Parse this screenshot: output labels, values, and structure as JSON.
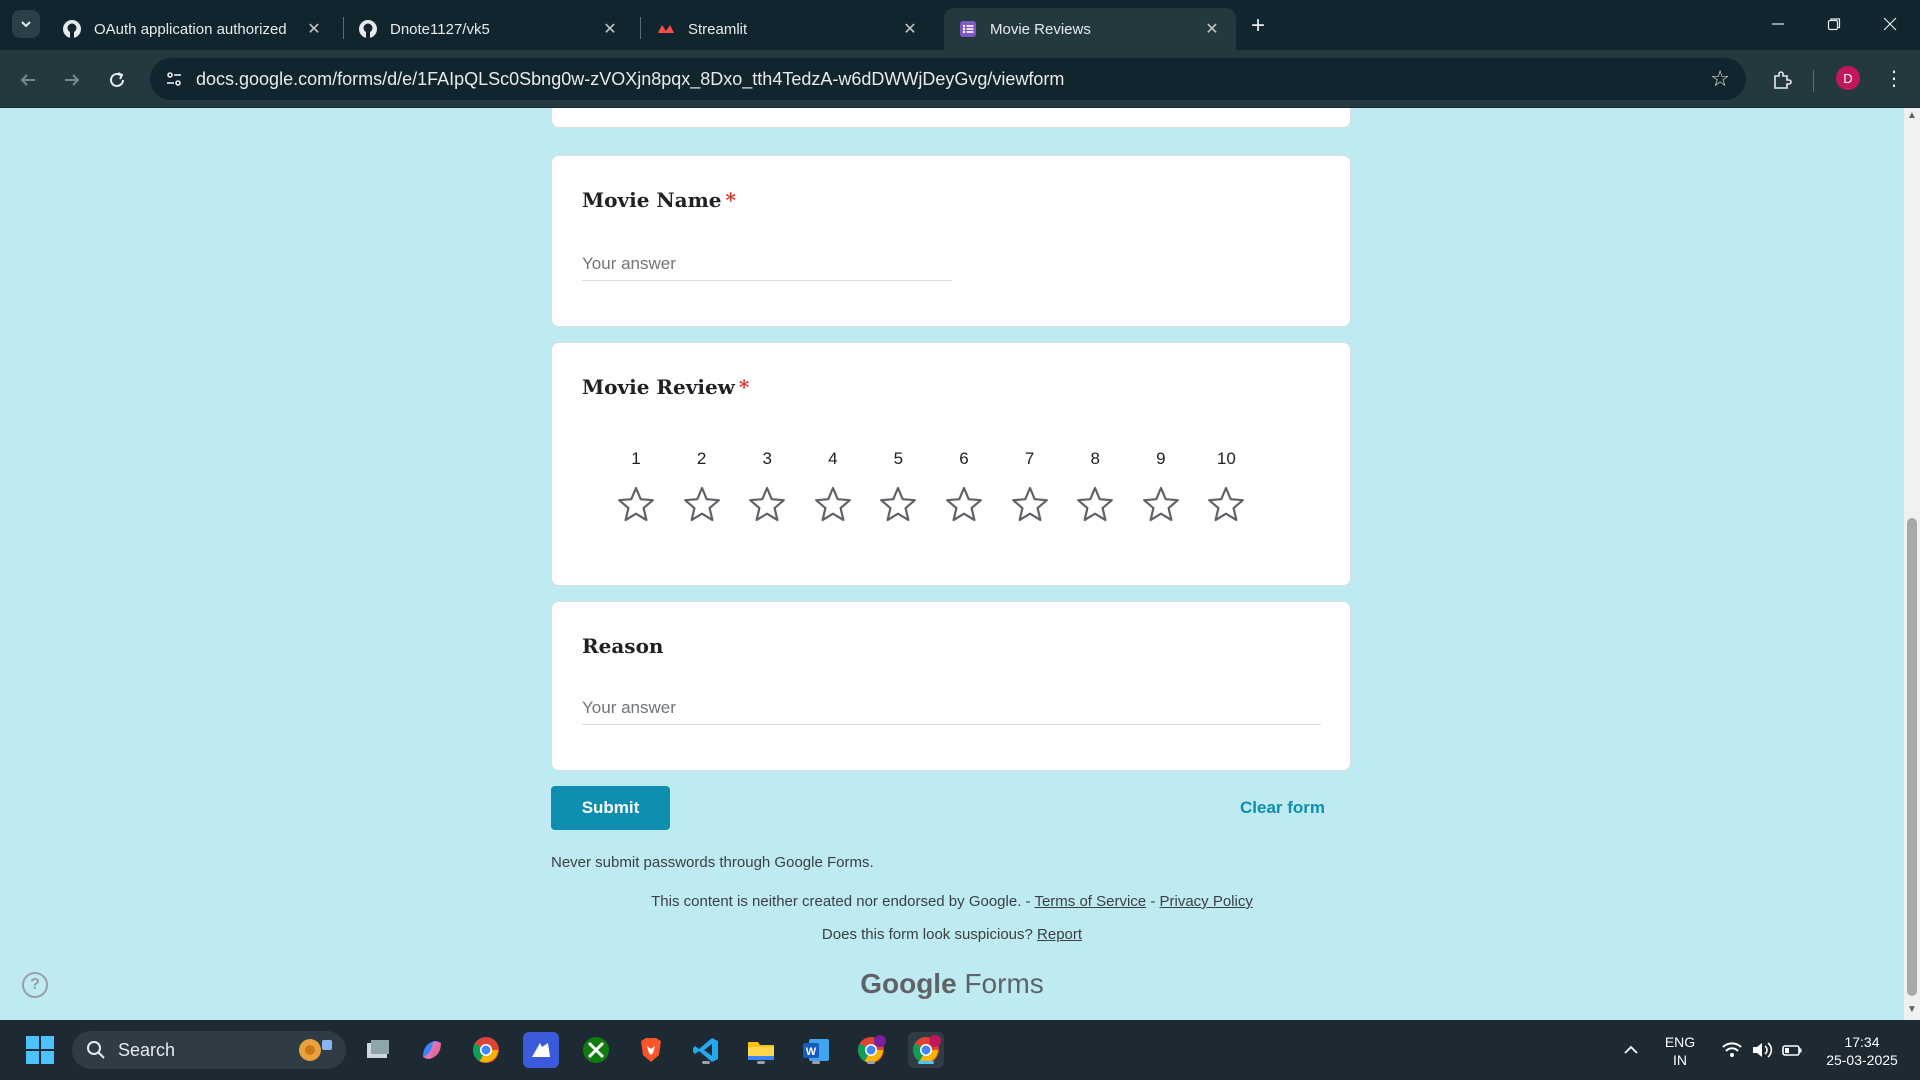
{
  "browser": {
    "tabs": [
      {
        "title": "OAuth application authorized",
        "icon": "github-icon",
        "active": false
      },
      {
        "title": "Dnote1127/vk5",
        "icon": "github-icon",
        "active": false
      },
      {
        "title": "Streamlit",
        "icon": "streamlit-icon",
        "active": false
      },
      {
        "title": "Movie Reviews",
        "icon": "google-forms-icon",
        "active": true
      }
    ],
    "url": "docs.google.com/forms/d/e/1FAIpQLSc0Sbng0w-zVOXjn8pqx_8Dxo_tth4TedzA-w6dDWWjDeyGvg/viewform",
    "profile_initial": "D"
  },
  "form": {
    "questions": {
      "movie_name": {
        "title": "Movie Name",
        "required_mark": "*",
        "placeholder": "Your answer"
      },
      "movie_review": {
        "title": "Movie Review",
        "required_mark": "*",
        "scale": [
          "1",
          "2",
          "3",
          "4",
          "5",
          "6",
          "7",
          "8",
          "9",
          "10"
        ],
        "rating": null
      },
      "reason": {
        "title": "Reason",
        "placeholder": "Your answer"
      }
    },
    "submit_label": "Submit",
    "clear_label": "Clear form",
    "never_submit": "Never submit passwords through Google Forms.",
    "disclaimer": "This content is neither created nor endorsed by Google. -",
    "terms": "Terms of Service",
    "dash": "-",
    "privacy": "Privacy Policy",
    "suspicious": "Does this form look suspicious?",
    "report": "Report",
    "brand_google": "Google",
    "brand_forms": "Forms"
  },
  "taskbar": {
    "search_label": "Search",
    "lang_top": "ENG",
    "lang_bottom": "IN",
    "time": "17:34",
    "date": "25-03-2025"
  },
  "colors": {
    "page_bg": "#bdebf1",
    "accent": "#0f8fb0",
    "required": "#d93025"
  }
}
